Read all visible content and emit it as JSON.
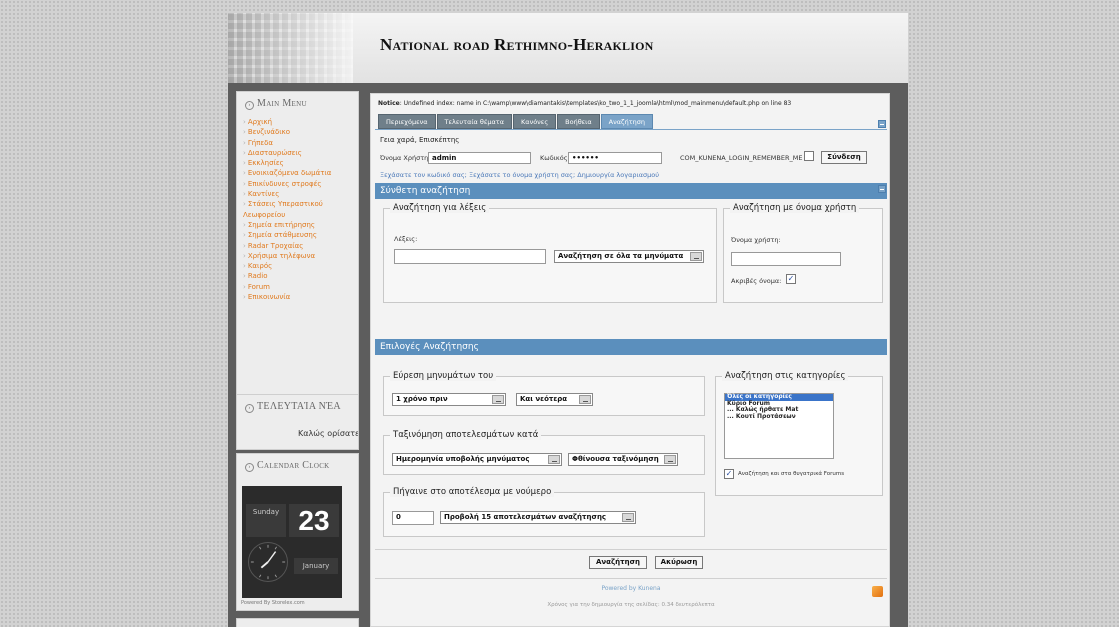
{
  "site": {
    "title": "National road Rethimno-Heraklion"
  },
  "sidebar": {
    "main_menu_title": "Main Menu",
    "menu_items": [
      "Αρχική",
      "Βενζινάδικο",
      "Γήπεδα",
      "Διασταυρώσεις",
      "Εκκλησίες",
      "Ενοικιαζόμενα δωμάτια",
      "Επικίνδυνες στροφές",
      "Καντίνες",
      "Στάσεις Υπεραστικού Λεωφορείου",
      "Σημεία επιτήρησης",
      "Σημεία στάθμευσης",
      "Radar Τροχαίας",
      "Χρήσιμα τηλέφωνα",
      "Καιρός",
      "Radio",
      "Forum",
      "Επικοινωνία"
    ],
    "news_title": "Τελευταία Νέα",
    "news_text": "Καλώς ορίσατε",
    "calendar_title": "Calendar Clock",
    "clock": {
      "day": "Sunday",
      "date": "23",
      "month": "January"
    },
    "powered": "Powered By Storelex.com"
  },
  "main": {
    "notice_label": "Notice",
    "notice_text": ": Undefined index: name in C:\\wamp\\www\\diamantakis\\templates\\ko_two_1_1_joomla\\html\\mod_mainmenu\\default.php on line 83",
    "tabs": [
      "Περιεχόμενα",
      "Τελευταία θέματα",
      "Κανόνες",
      "Βοήθεια",
      "Αναζήτηση"
    ],
    "active_tab": 4,
    "greeting": "Γεια χαρά, Επισκέπτης",
    "login": {
      "username_label": "Όνομα Χρήστη",
      "username_value": "admin",
      "password_label": "Κωδικός",
      "password_value": "••••••",
      "remember_label": "COM_KUNENA_LOGIN_REMEMBER_ME",
      "login_button": "Σύνδεση"
    },
    "links": {
      "forgot_password": "Ξεχάσατε τον κωδικό σας;",
      "forgot_username": "Ξεχάσατε το όνομα χρήστη σας;",
      "create_account": "Δημιουργία λογαριασμού"
    },
    "advanced_search": {
      "title": "Σύνθετη αναζήτηση",
      "words_legend": "Αναζήτηση για λέξεις",
      "words_label": "Λέξεις:",
      "words_value": "",
      "words_scope": "Αναζήτηση σε όλα τα μηνύματα",
      "user_legend": "Αναζήτηση με όνομα χρήστη",
      "user_label": "Όνομα χρήστη:",
      "user_value": "",
      "exact_label": "Ακριβές όνομα:"
    },
    "search_options": {
      "title": "Επιλογές Αναζήτησης",
      "find_legend": "Εύρεση μηνυμάτων του",
      "find_period": "1 χρόνο πριν",
      "find_direction": "Και νεότερα",
      "sort_legend": "Ταξινόμηση αποτελεσμάτων κατά",
      "sort_field": "Ημερομηνία υποβολής μηνύματος",
      "sort_order": "Φθίνουσα ταξινόμηση",
      "goto_legend": "Πήγαινε στο αποτέλεσμα με νούμερο",
      "goto_value": "0",
      "goto_show": "Προβολή 15 αποτελεσμάτων αναζήτησης",
      "categories_legend": "Αναζήτηση στις κατηγορίες",
      "categories": [
        "Όλες οι κατηγορίες",
        "Κύριο Forum",
        "... Καλώς ήρθατε Mat",
        "... Κουτί Προτάσεων"
      ],
      "subforums_label": "Αναζήτηση και στα θυγατρικά Forums"
    },
    "buttons": {
      "search": "Αναζήτηση",
      "cancel": "Ακύρωση"
    },
    "footer": {
      "powered": "Powered by Kunena",
      "time": "Χρόνος για την δημιουργία της σελίδας: 0.34 δευτερόλεπτα"
    }
  }
}
